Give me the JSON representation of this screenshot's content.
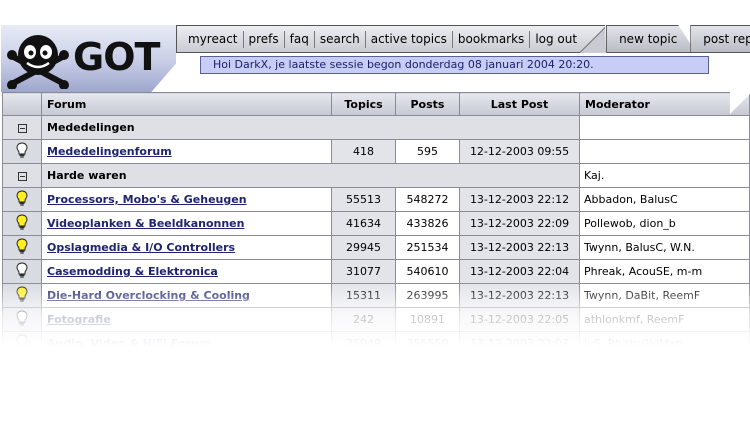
{
  "brand": {
    "logo_text": "GOT"
  },
  "nav": {
    "links": [
      "myreact",
      "prefs",
      "faq",
      "search",
      "active topics",
      "bookmarks",
      "log out"
    ],
    "new_topic": "new topic",
    "post_reply": "post reply"
  },
  "welcome": "Hoi DarkX, je laatste sessie begon donderdag 08 januari 2004 20:20.",
  "table": {
    "headers": {
      "forum": "Forum",
      "topics": "Topics",
      "posts": "Posts",
      "last_post": "Last Post",
      "moderator": "Moderator"
    },
    "categories": [
      {
        "name": "Mededelingen",
        "moderator": "",
        "forums": [
          {
            "name": "Mededelingenforum",
            "topics": "418",
            "posts": "595",
            "last_post": "12-12-2003 09:55",
            "moderator": "",
            "new": false
          }
        ]
      },
      {
        "name": "Harde waren",
        "moderator": "Kaj.",
        "forums": [
          {
            "name": "Processors, Mobo's & Geheugen",
            "topics": "55513",
            "posts": "548272",
            "last_post": "13-12-2003 22:12",
            "moderator": "Abbadon, BalusC",
            "new": true
          },
          {
            "name": "Videoplanken & Beeldkanonnen",
            "topics": "41634",
            "posts": "433826",
            "last_post": "13-12-2003 22:09",
            "moderator": "Pollewob, dion_b",
            "new": true
          },
          {
            "name": "Opslagmedia & I/O Controllers",
            "topics": "29945",
            "posts": "251534",
            "last_post": "13-12-2003 22:13",
            "moderator": "Twynn, BalusC, W.N.",
            "new": true
          },
          {
            "name": "Casemodding & Elektronica",
            "topics": "31077",
            "posts": "540610",
            "last_post": "13-12-2003 22:04",
            "moderator": "Phreak, AcouSE, m-m",
            "new": false
          },
          {
            "name": "Die-Hard Overclocking & Cooling",
            "topics": "15311",
            "posts": "263995",
            "last_post": "13-12-2003 22:13",
            "moderator": "Twynn, DaBit, ReemF",
            "new": true
          },
          {
            "name": "Fotografie",
            "topics": "242",
            "posts": "10891",
            "last_post": "13-12-2003 22:05",
            "moderator": "athlonkmf, ReemF",
            "new": false
          },
          {
            "name": "Audio, Video & HiFi Forum",
            "topics": "35949",
            "posts": "355559",
            "last_post": "13-12-2003 22:07",
            "moderator": "JvS, RhittyOldMan",
            "new": false
          }
        ]
      }
    ]
  },
  "colors": {
    "link": "#1e2470",
    "bulb_new": "#ffee22",
    "welcome_bg": "#c7cdf5"
  },
  "icons": {
    "logo": "got-mascot-icon",
    "new_posts": "lightbulb-on-icon",
    "no_new_posts": "lightbulb-off-icon",
    "category": "collapse-icon"
  }
}
